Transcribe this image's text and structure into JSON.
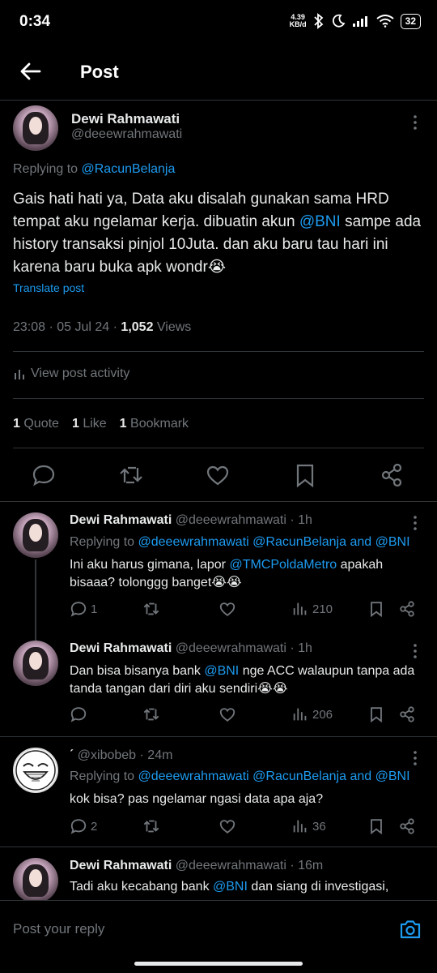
{
  "status_bar": {
    "time": "0:34",
    "speed_value": "4.39",
    "speed_unit": "KB/d",
    "battery": "32"
  },
  "header": {
    "title": "Post"
  },
  "main_post": {
    "name": "Dewi Rahmawati",
    "handle": "@deeewrahmawati",
    "replying_prefix": "Replying to ",
    "replying_to": "@RacunBelanja",
    "text_part1": "Gais hati hati ya, Data aku disalah gunakan sama HRD tempat aku ngelamar kerja. dibuatin akun ",
    "mention": "@BNI",
    "text_part2": "  sampe ada history transaksi pinjol 10Juta. dan aku baru tau hari ini karena baru buka apk wondr😭",
    "translate": "Translate post",
    "timestamp": "23:08 · 05 Jul 24 · ",
    "views_count": "1,052",
    "views_label": " Views",
    "activity": "View post activity",
    "stats": [
      {
        "count": "1",
        "label": "Quote"
      },
      {
        "count": "1",
        "label": "Like"
      },
      {
        "count": "1",
        "label": "Bookmark"
      }
    ]
  },
  "replies": [
    {
      "name": "Dewi Rahmawati",
      "handle_time": "@deeewrahmawati · 1h",
      "replying_prefix": "Replying to ",
      "replying_to": "@deeewrahmawati @RacunBelanja and @BNI",
      "text_a": "Ini aku harus gimana, lapor ",
      "mention": "@TMCPoldaMetro",
      "text_b": " apakah bisaaa? tolonggg banget😭😭",
      "replies": "1",
      "views": "210"
    },
    {
      "name": "Dewi Rahmawati",
      "handle_time": "@deeewrahmawati · 1h",
      "text_a": "Dan bisa bisanya bank ",
      "mention": "@BNI",
      "text_b": " nge ACC walaupun tanpa ada tanda tangan dari diri aku sendiri😭😭",
      "replies": "",
      "views": "206"
    },
    {
      "name": "ˊ",
      "handle_time": "@xibobeb · 24m",
      "replying_prefix": "Replying to ",
      "replying_to": "@deeewrahmawati @RacunBelanja and @BNI",
      "text_a": "kok bisa? pas ngelamar ngasi data apa aja?",
      "replies": "2",
      "views": "36"
    },
    {
      "name": "Dewi Rahmawati",
      "handle_time": "@deeewrahmawati · 16m",
      "text_a": "Tadi aku kecabang bank ",
      "mention": "@BNI",
      "text_b": " dan siang di investigasi,"
    }
  ],
  "compose": {
    "placeholder": "Post your reply"
  },
  "colors": {
    "accent": "#1d9bf0",
    "muted": "#71767b",
    "background": "#000000",
    "divider": "#2f3336"
  },
  "icons": [
    "back-arrow-icon",
    "more-dots-icon",
    "reply-icon",
    "repost-icon",
    "like-icon",
    "bookmark-icon",
    "share-icon",
    "views-icon",
    "camera-icon",
    "bar-chart-icon"
  ]
}
